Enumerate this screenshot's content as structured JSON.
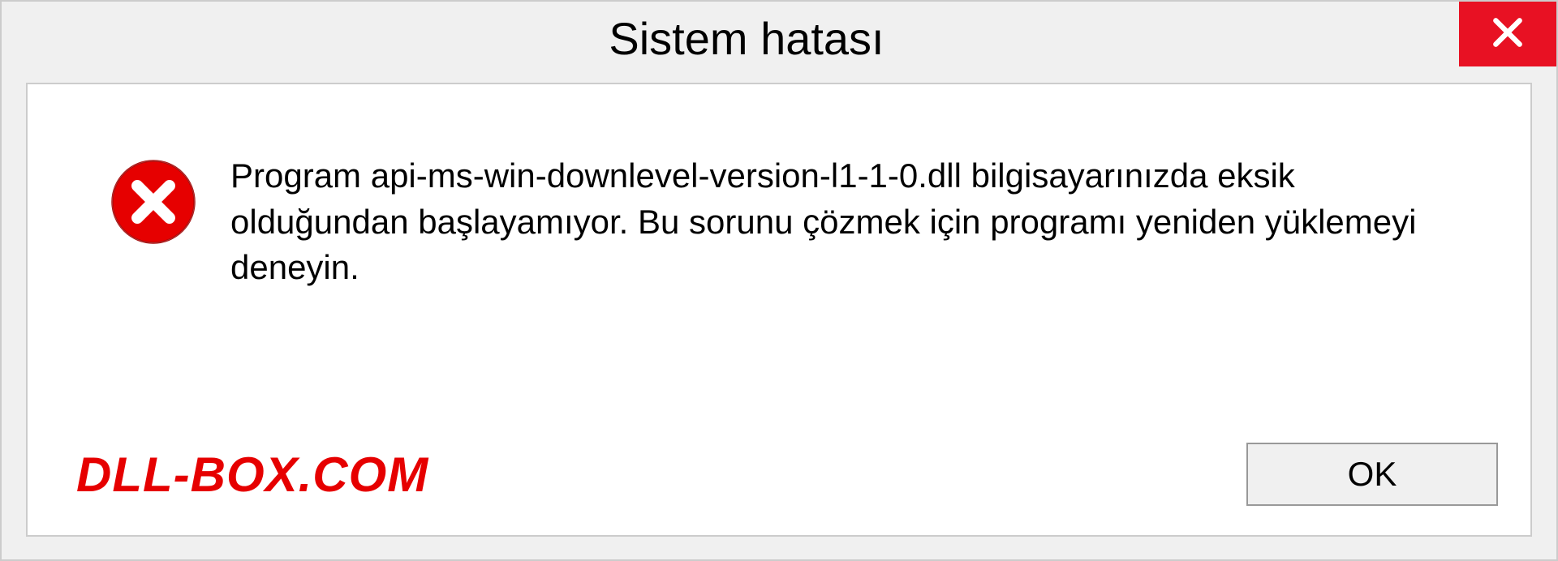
{
  "dialog": {
    "title": "Sistem hatası",
    "message": "Program api-ms-win-downlevel-version-l1-1-0.dll bilgisayarınızda eksik olduğundan başlayamıyor. Bu sorunu çözmek için programı yeniden yüklemeyi deneyin.",
    "ok_label": "OK"
  },
  "watermark": "DLL-BOX.COM"
}
